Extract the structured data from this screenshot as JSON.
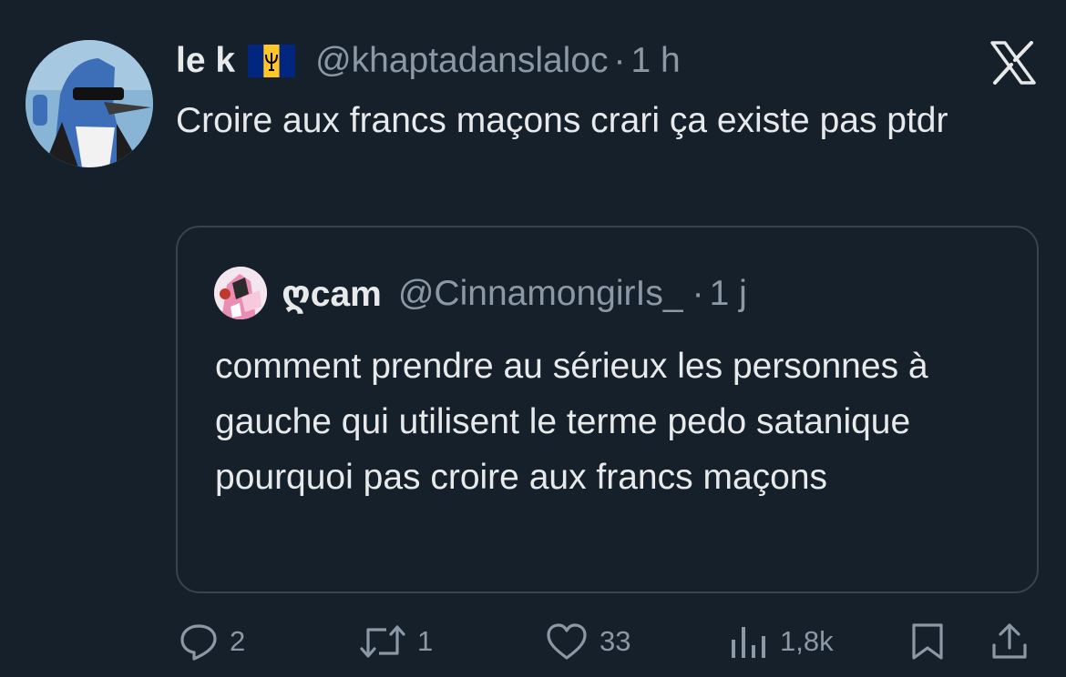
{
  "tweet": {
    "author": {
      "display_name": "le k",
      "flag_icon": "barbados-flag-icon",
      "handle": "@khaptadanslaloc",
      "separator": "·",
      "time": "1 h"
    },
    "text": "Croire aux francs maçons crari ça existe pas ptdr",
    "platform_icon": "x-logo-icon"
  },
  "quoted_tweet": {
    "author": {
      "display_name": "ღcam",
      "handle": "@CinnamongirIs_",
      "separator": "·",
      "time": "1 j"
    },
    "text": "comment prendre au sérieux les personnes à gauche qui utilisent le terme pedo satanique pourquoi pas croire aux francs maçons"
  },
  "actions": {
    "reply": {
      "icon": "reply-icon",
      "count": "2"
    },
    "retweet": {
      "icon": "retweet-icon",
      "count": "1"
    },
    "like": {
      "icon": "heart-icon",
      "count": "33"
    },
    "views": {
      "icon": "views-icon",
      "count": "1,8k"
    },
    "bookmark": {
      "icon": "bookmark-icon"
    },
    "share": {
      "icon": "share-icon"
    }
  },
  "colors": {
    "background": "#15202b",
    "text_primary": "#e7e9ea",
    "text_secondary": "#8b98a5",
    "border": "#38444d"
  }
}
